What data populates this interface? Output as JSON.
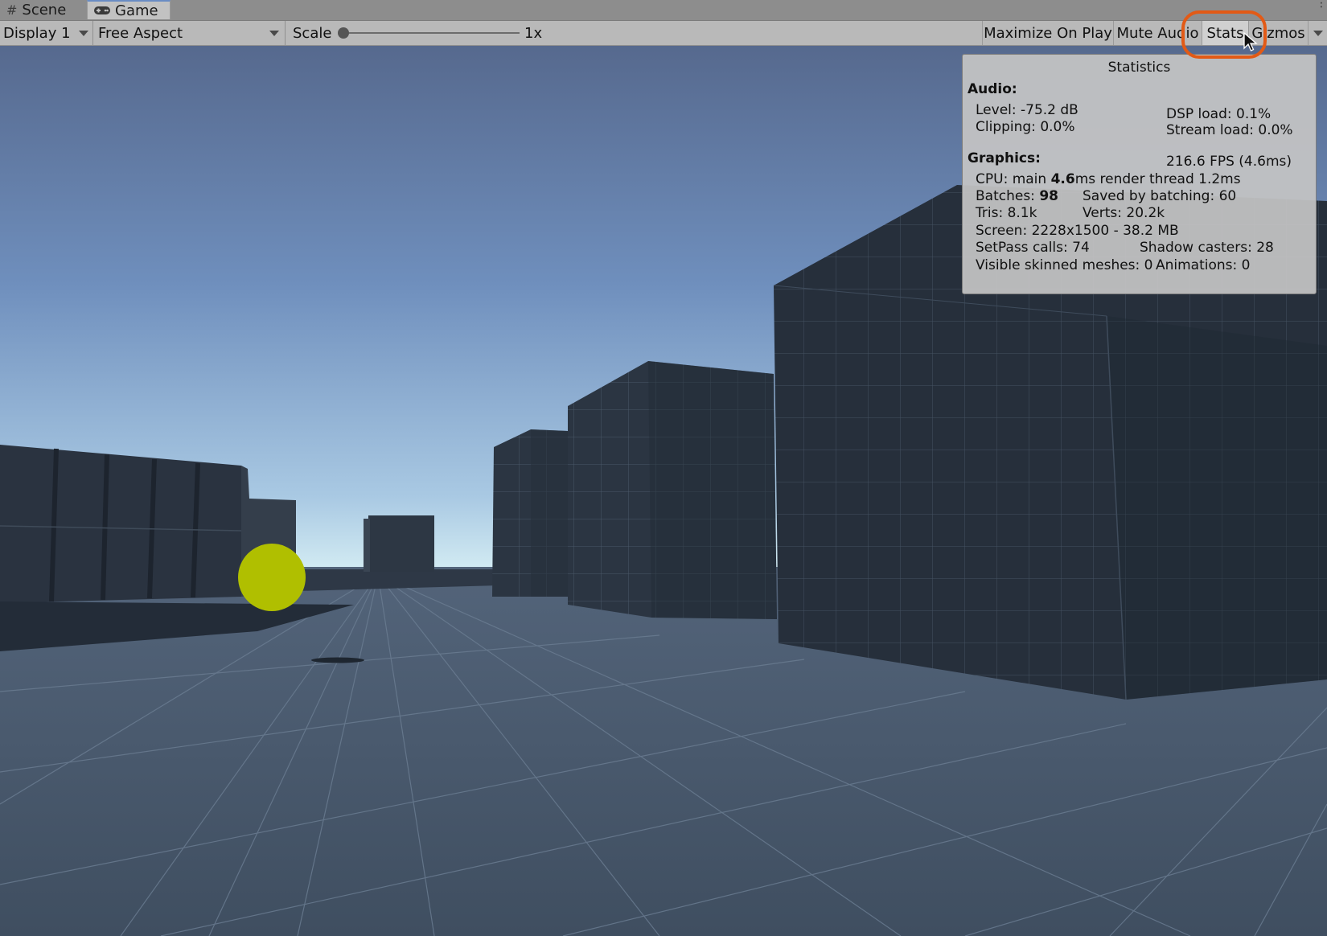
{
  "tabs": [
    {
      "label": "Scene",
      "icon": "grid-icon"
    },
    {
      "label": "Game",
      "icon": "gamepad-icon",
      "active": true
    }
  ],
  "toolbar": {
    "display": "Display 1",
    "aspect": "Free Aspect",
    "scale_label": "Scale",
    "scale_value": "1x",
    "scale_slider_fraction": 0,
    "buttons": [
      {
        "label": "Maximize On Play",
        "active": false
      },
      {
        "label": "Mute Audio",
        "active": false
      },
      {
        "label": "Stats",
        "active": true
      },
      {
        "label": "Gizmos",
        "active": false
      }
    ]
  },
  "highlight_color": "#e25a16",
  "stats": {
    "title": "Statistics",
    "audio_heading": "Audio:",
    "level": "Level: -75.2 dB",
    "clipping": "Clipping: 0.0%",
    "dsp_load": "DSP load: 0.1%",
    "stream_load": "Stream load: 0.0%",
    "graphics_heading": "Graphics:",
    "fps": "216.6 FPS (4.6ms)",
    "cpu_prefix": "CPU: main ",
    "cpu_main": "4.6",
    "cpu_suffix": "ms  render thread 1.2ms",
    "batches_prefix": "Batches: ",
    "batches": "98",
    "saved_by_batching": "Saved by batching: 60",
    "tris": "Tris: 8.1k",
    "verts": "Verts: 20.2k",
    "screen": "Screen: 2228x1500 - 38.2 MB",
    "setpass": "SetPass calls: 74",
    "shadow_casters": "Shadow casters: 28",
    "skinned_meshes": "Visible skinned meshes: 0",
    "animations": "Animations: 0"
  }
}
